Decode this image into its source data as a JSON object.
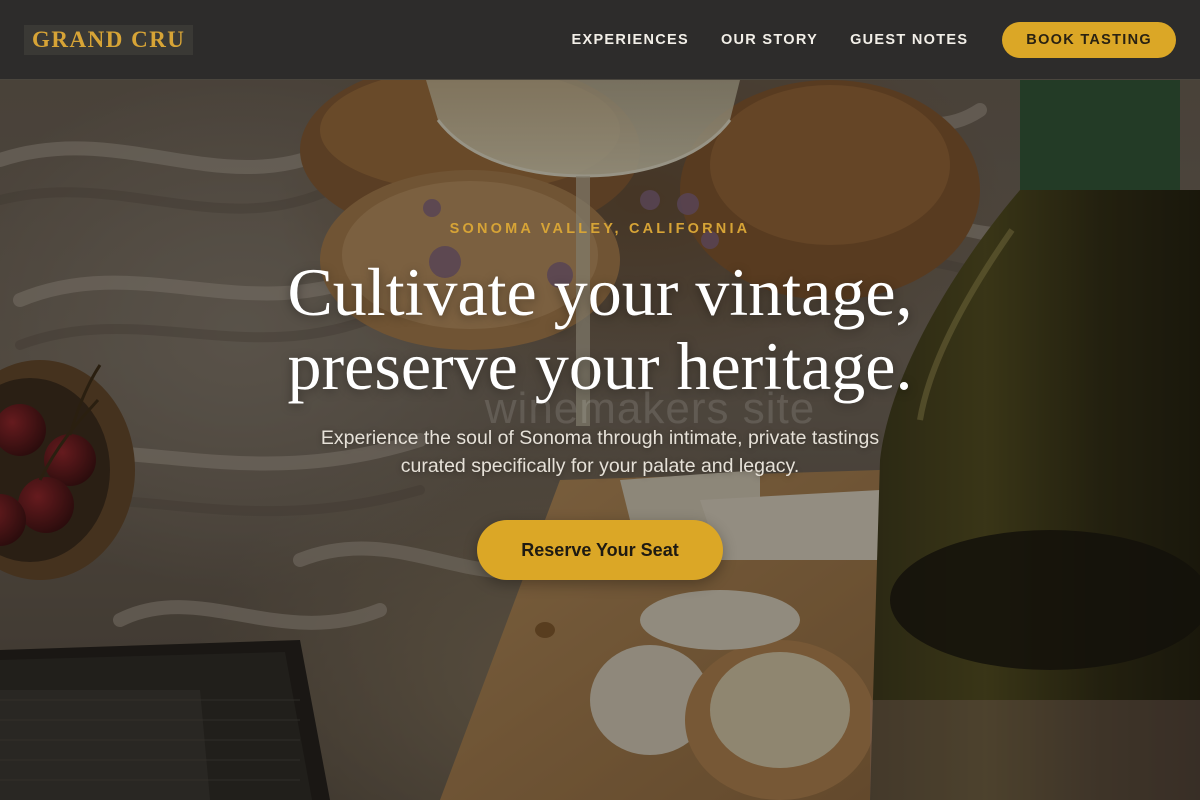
{
  "brand": {
    "name": "GRAND CRU"
  },
  "nav": {
    "links": [
      {
        "label": "EXPERIENCES"
      },
      {
        "label": "OUR STORY"
      },
      {
        "label": "GUEST NOTES"
      }
    ],
    "cta_label": "BOOK TASTING"
  },
  "hero": {
    "eyebrow": "SONOMA VALLEY, CALIFORNIA",
    "headline_line1": "Cultivate your vintage,",
    "headline_line2": "preserve your heritage.",
    "watermark": "winemakers site",
    "subtitle_line1": "Experience the soul of Sonoma through intimate, private tastings",
    "subtitle_line2": "curated specifically for your palate and legacy.",
    "cta_label": "Reserve Your Seat"
  },
  "colors": {
    "accent": "#dba726",
    "brand_gold": "#d7a436",
    "nav_bg": "#2d2c2b",
    "headline": "#ffffff"
  },
  "background": {
    "description_icons": [
      "wine-glass-icon",
      "wine-bottle-icon",
      "cherry-bowl-icon",
      "bread-icon",
      "cheese-board-icon",
      "book-icon",
      "picnic-blanket"
    ]
  }
}
